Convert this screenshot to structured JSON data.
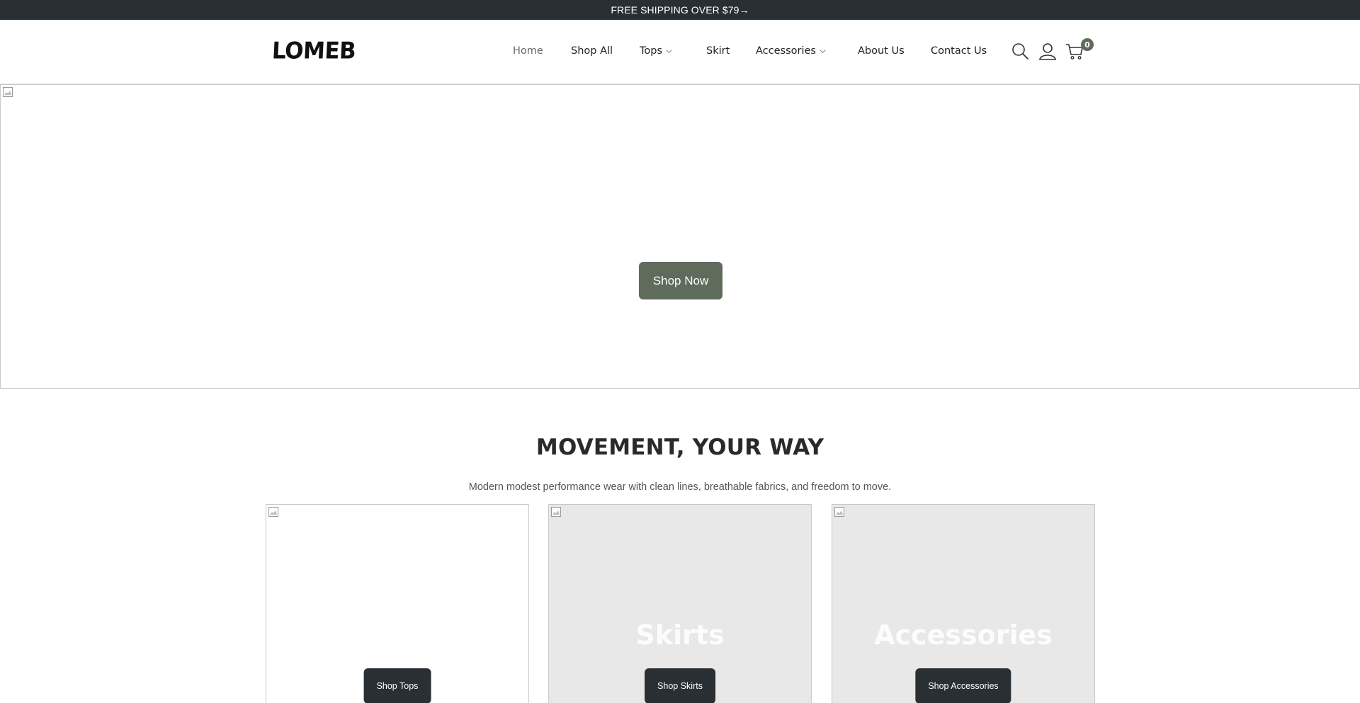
{
  "announcement": {
    "text": "FREE SHIPPING OVER $79→"
  },
  "header": {
    "logo": "LOMEB",
    "nav": [
      {
        "label": "Home",
        "active": true
      },
      {
        "label": "Shop All"
      },
      {
        "label": "Tops",
        "dropdown": true
      },
      {
        "label": "Skirt"
      },
      {
        "label": "Accessories",
        "dropdown": true
      },
      {
        "label": "About Us"
      },
      {
        "label": "Contact Us"
      }
    ],
    "icons": [
      "search-icon",
      "account-icon",
      "cart-icon"
    ],
    "cart_count": "0"
  },
  "hero": {
    "button_label": "Shop Now"
  },
  "collection": {
    "title": "MOVEMENT, YOUR WAY",
    "subtitle": "Modern modest performance wear with clean lines, breathable fabrics, and freedom to move.",
    "cards": [
      {
        "title": "",
        "button_label": "Shop Tops"
      },
      {
        "title": "Skirts",
        "button_label": "Shop Skirts"
      },
      {
        "title": "Accessories",
        "button_label": "Shop Accessories"
      }
    ]
  },
  "colors": {
    "accent": "#5f6b5b",
    "dark": "#2a2f33"
  }
}
